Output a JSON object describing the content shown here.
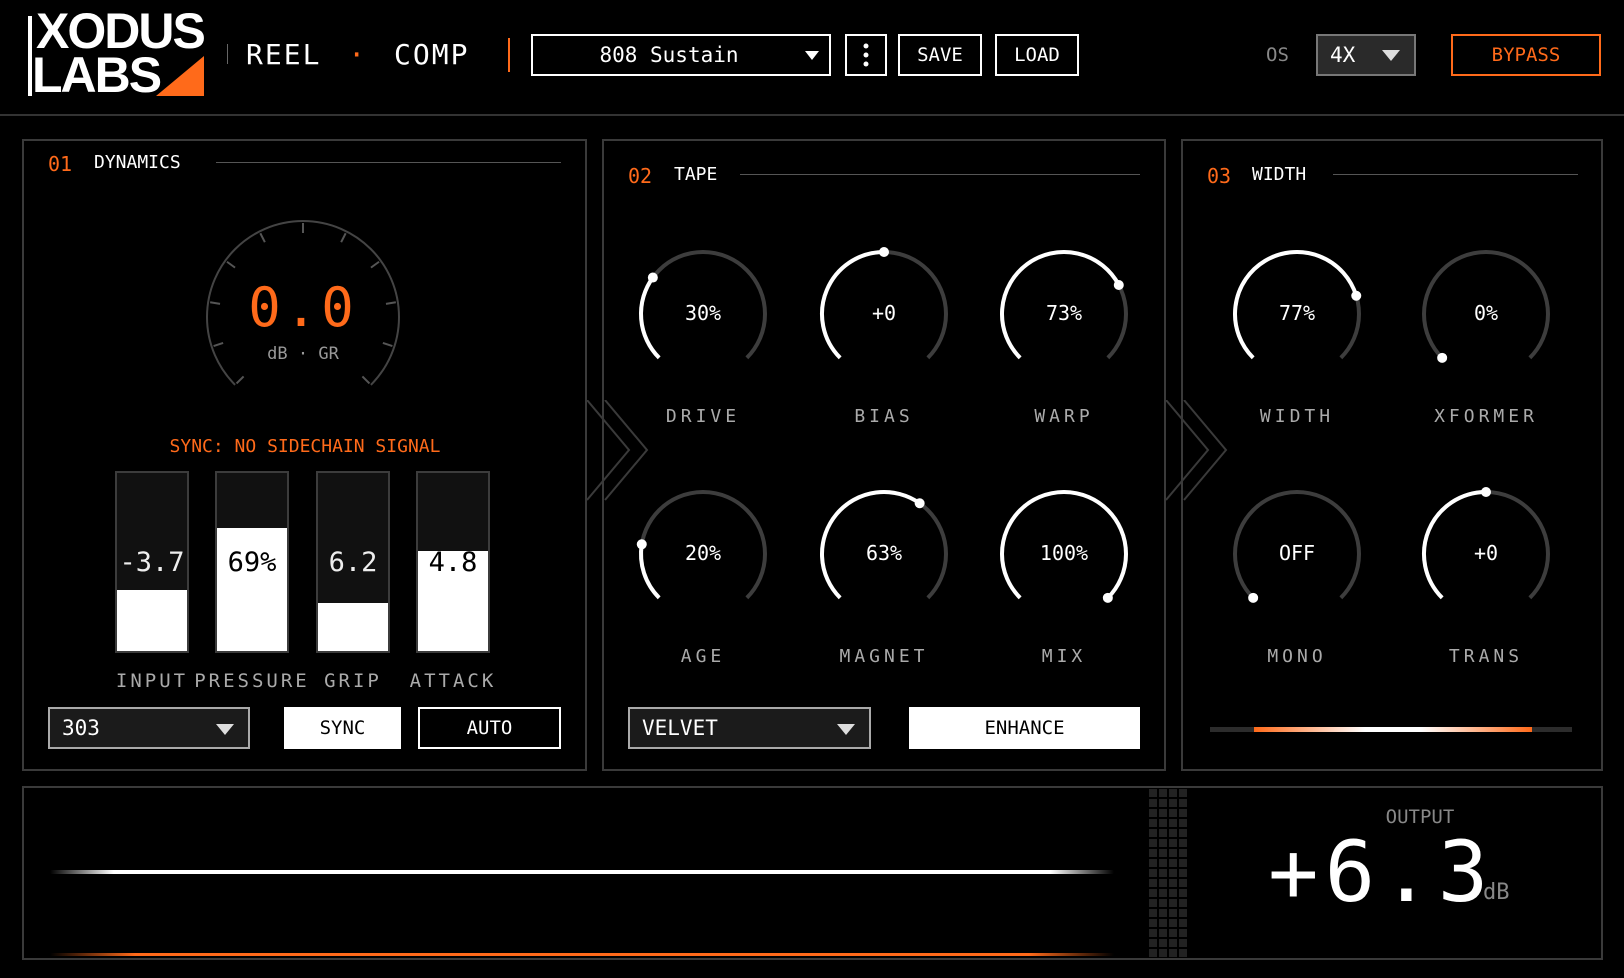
{
  "brand": {
    "line1": "XODUS",
    "line2": "LABS",
    "accent": "#ff6a1a"
  },
  "header": {
    "product_left": "REEL",
    "product_sep": "·",
    "product_right": "COMP",
    "preset": "808 Sustain",
    "more_icon": "vertical-dots-icon",
    "save": "SAVE",
    "load": "LOAD",
    "os_label": "OS",
    "os_value": "4X",
    "bypass": "BYPASS"
  },
  "dynamics": {
    "num": "01",
    "title": "DYNAMICS",
    "gr_value": "0.0",
    "gr_unit": "dB · GR",
    "sync_status": "SYNC: NO SIDECHAIN SIGNAL",
    "meters": [
      {
        "label": "INPUT",
        "value": "-3.7",
        "level": 0.34
      },
      {
        "label": "PRESSURE",
        "value": "69%",
        "level": 0.69
      },
      {
        "label": "GRIP",
        "value": "6.2",
        "level": 0.27
      },
      {
        "label": "ATTACK",
        "value": "4.8",
        "level": 0.56
      }
    ],
    "mode_select": "303",
    "sync_button": "SYNC",
    "auto_button": "AUTO"
  },
  "tape": {
    "num": "02",
    "title": "TAPE",
    "knobs": [
      {
        "label": "DRIVE",
        "value": "30%",
        "level": 0.3
      },
      {
        "label": "BIAS",
        "value": "+0",
        "level": 0.5
      },
      {
        "label": "WARP",
        "value": "73%",
        "level": 0.73
      },
      {
        "label": "AGE",
        "value": "20%",
        "level": 0.2
      },
      {
        "label": "MAGNET",
        "value": "63%",
        "level": 0.63
      },
      {
        "label": "MIX",
        "value": "100%",
        "level": 1.0
      }
    ],
    "character_select": "VELVET",
    "enhance_button": "ENHANCE"
  },
  "width": {
    "num": "03",
    "title": "WIDTH",
    "knobs": [
      {
        "label": "WIDTH",
        "value": "77%",
        "level": 0.77
      },
      {
        "label": "XFORMER",
        "value": "0%",
        "level": 0.0
      },
      {
        "label": "MONO",
        "value": "OFF",
        "level": 0.0
      },
      {
        "label": "TRANS",
        "value": "+0",
        "level": 0.5
      }
    ]
  },
  "output": {
    "label": "OUTPUT",
    "value": "+6.3",
    "unit": "dB"
  }
}
